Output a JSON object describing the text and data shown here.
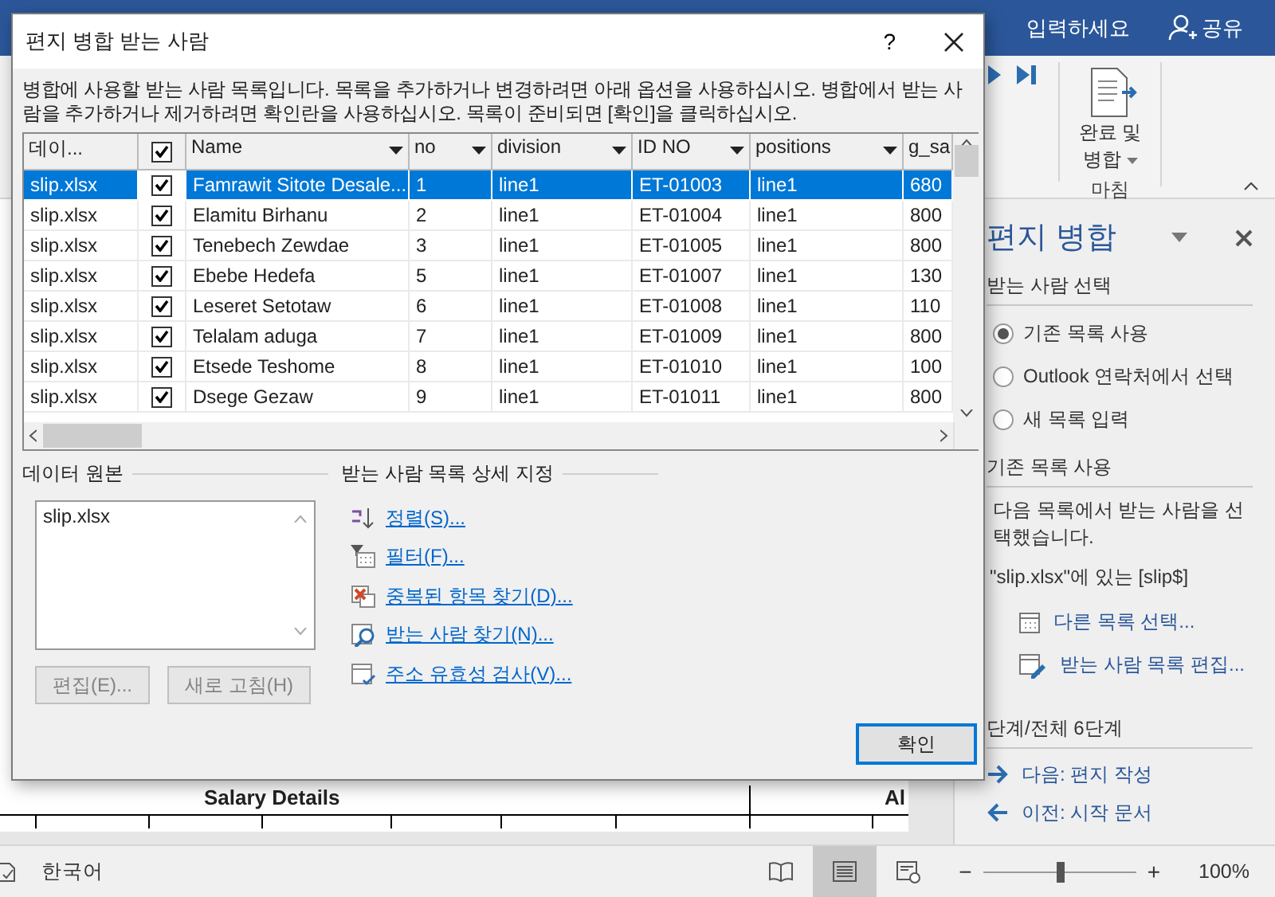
{
  "app": {
    "search_hint": "입력하세요",
    "share": "공유"
  },
  "ribbon": {
    "finish_button": "완료 및 병합",
    "group_label": "마침"
  },
  "document": {
    "heading": "Salary Details",
    "heading_2": "Al"
  },
  "dialog": {
    "title": "편지 병합 받는 사람",
    "help": "?",
    "description": "병합에 사용할 받는 사람 목록입니다. 목록을 추가하거나 변경하려면 아래 옵션을 사용하십시오. 병합에서 받는 사람을 추가하거나 제거하려면 확인란을 사용하십시오. 목록이 준비되면 [확인]을 클릭하십시오.",
    "select_all": {
      "checked": true
    },
    "columns": [
      {
        "kind": "plain",
        "label": "데이..."
      },
      {
        "kind": "dropdown",
        "label": "Name"
      },
      {
        "kind": "dropdown",
        "label": "no"
      },
      {
        "kind": "dropdown",
        "label": "division"
      },
      {
        "kind": "dropdown",
        "label": "ID NO"
      },
      {
        "kind": "dropdown",
        "label": "positions"
      },
      {
        "kind": "plain",
        "label": "g_sa"
      }
    ],
    "rows": [
      {
        "selected": true,
        "checked": true,
        "cells": [
          "slip.xlsx",
          "Famrawit Sitote Desale...",
          "1",
          "line1",
          "ET-01003",
          "line1",
          "680"
        ]
      },
      {
        "selected": false,
        "checked": true,
        "cells": [
          "slip.xlsx",
          "Elamitu Birhanu",
          "2",
          "line1",
          "ET-01004",
          "line1",
          "800"
        ]
      },
      {
        "selected": false,
        "checked": true,
        "cells": [
          "slip.xlsx",
          "Tenebech Zewdae",
          "3",
          "line1",
          "ET-01005",
          "line1",
          "800"
        ]
      },
      {
        "selected": false,
        "checked": true,
        "cells": [
          "slip.xlsx",
          "Ebebe Hedefa",
          "5",
          "line1",
          "ET-01007",
          "line1",
          "130"
        ]
      },
      {
        "selected": false,
        "checked": true,
        "cells": [
          "slip.xlsx",
          "Leseret Setotaw",
          "6",
          "line1",
          "ET-01008",
          "line1",
          "110"
        ]
      },
      {
        "selected": false,
        "checked": true,
        "cells": [
          "slip.xlsx",
          "Telalam aduga",
          "7",
          "line1",
          "ET-01009",
          "line1",
          "800"
        ]
      },
      {
        "selected": false,
        "checked": true,
        "cells": [
          "slip.xlsx",
          "Etsede Teshome",
          "8",
          "line1",
          "ET-01010",
          "line1",
          "100"
        ]
      },
      {
        "selected": false,
        "checked": true,
        "cells": [
          "slip.xlsx",
          "Dsege Gezaw",
          "9",
          "line1",
          "ET-01011",
          "line1",
          "800"
        ]
      }
    ],
    "data_source": {
      "label": "데이터 원본",
      "items": [
        "slip.xlsx"
      ],
      "buttons": [
        {
          "label": "편집(E)...",
          "disabled": true
        },
        {
          "label": "새로 고침(H)",
          "disabled": true
        }
      ]
    },
    "refine": {
      "label": "받는 사람 목록 상세 지정",
      "links": [
        {
          "kind": "sort",
          "label": "정렬(S)..."
        },
        {
          "kind": "filter",
          "label": "필터(F)..."
        },
        {
          "kind": "duplicates",
          "label": "중복된 항목 찾기(D)..."
        },
        {
          "kind": "find",
          "label": "받는 사람 찾기(N)..."
        },
        {
          "kind": "validate",
          "label": "주소 유효성 검사(V)..."
        }
      ]
    },
    "ok": "확인"
  },
  "task_pane": {
    "title": "편지 병합",
    "section_1": "받는 사람 선택",
    "options": [
      {
        "label": "기존 목록 사용",
        "selected": true
      },
      {
        "label": "Outlook 연락처에서 선택",
        "selected": false
      },
      {
        "label": "새 목록 입력",
        "selected": false
      }
    ],
    "section_2": "기존 목록 사용",
    "info": "다음 목록에서 받는 사람을 선택했습니다.",
    "source": "\"slip.xlsx\"에 있는 [slip$]",
    "actions": [
      {
        "kind": "select",
        "label": "다른 목록 선택..."
      },
      {
        "kind": "edit",
        "label": "받는 사람 목록 편집..."
      }
    ],
    "step": "단계/전체 6단계",
    "nav": [
      {
        "kind": "next",
        "label": "다음: 편지 작성"
      },
      {
        "kind": "prev",
        "label": "이전: 시작 문서"
      }
    ]
  },
  "status_bar": {
    "language": "한국어",
    "views": [
      {
        "kind": "read",
        "selected": false
      },
      {
        "kind": "print",
        "selected": true
      },
      {
        "kind": "web",
        "selected": false
      }
    ],
    "zoom_out": "−",
    "zoom_in": "+",
    "zoom": {
      "level": 0.5
    },
    "zoom_reading": "100%"
  }
}
